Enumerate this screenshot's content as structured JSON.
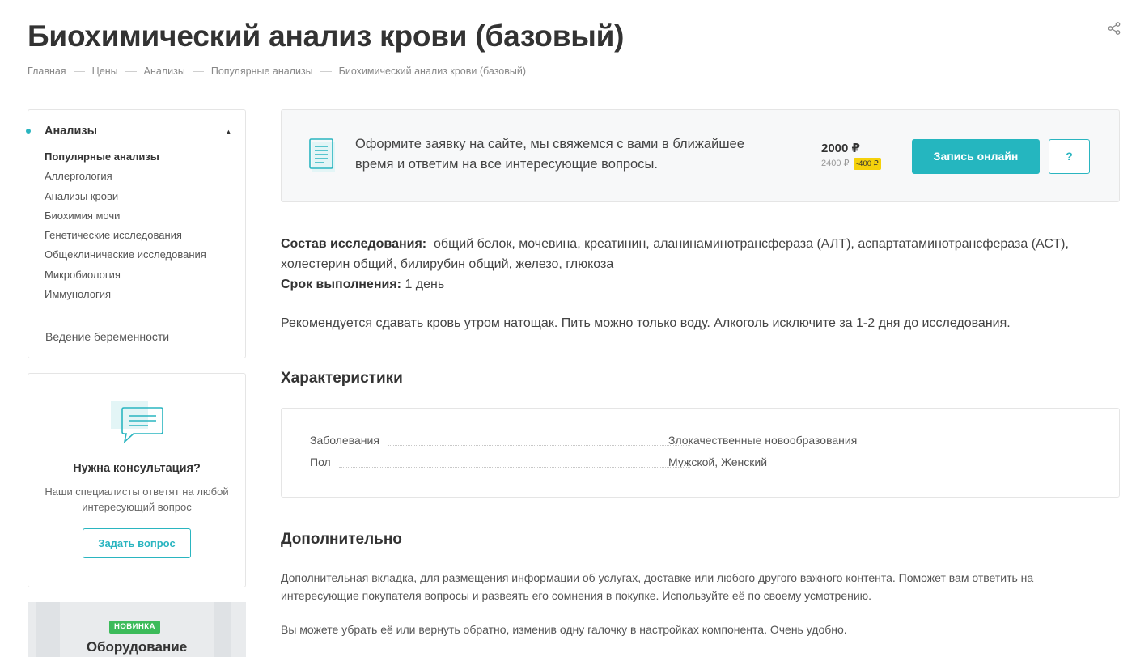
{
  "page": {
    "title": "Биохимический анализ крови (базовый)"
  },
  "breadcrumb": [
    "Главная",
    "Цены",
    "Анализы",
    "Популярные анализы",
    "Биохимический анализ крови (базовый)"
  ],
  "sidebar": {
    "heading": "Анализы",
    "items": [
      {
        "label": "Популярные анализы",
        "active": true
      },
      {
        "label": "Аллергология"
      },
      {
        "label": "Анализы крови"
      },
      {
        "label": "Биохимия мочи"
      },
      {
        "label": "Генетические исследования"
      },
      {
        "label": "Общеклинические исследования"
      },
      {
        "label": "Микробиология"
      },
      {
        "label": "Иммунология"
      }
    ],
    "extra_item": "Ведение беременности"
  },
  "consult": {
    "title": "Нужна консультация?",
    "text": "Наши специалисты ответят на любой интересующий вопрос",
    "button": "Задать вопрос"
  },
  "promo": {
    "badge": "НОВИНКА",
    "name": "Оборудование"
  },
  "order": {
    "text": "Оформите заявку на сайте, мы свяжемся с вами в ближайшее время и ответим на все интересующие вопросы.",
    "price": "2000 ₽",
    "old_price": "2400 ₽",
    "discount": "-400 ₽",
    "signup_button": "Запись онлайн",
    "question_button": "?"
  },
  "details": {
    "composition_label": "Состав исследования:",
    "composition_value": "общий белок, мочевина, креатинин, аланинаминотрансфераза (АЛТ), аспартатаминотрансфераза (АСТ), холестерин общий, билирубин общий, железо, глюкоза",
    "term_label": "Срок выполнения:",
    "term_value": "1 день",
    "recommendation": "Рекомендуется сдавать кровь утром натощак. Пить можно только воду. Алкоголь исключите за 1-2 дня до исследования."
  },
  "characteristics": {
    "heading": "Характеристики",
    "rows": [
      {
        "key": "Заболевания",
        "value": "Злокачественные новообразования"
      },
      {
        "key": "Пол",
        "value": "Мужской, Женский"
      }
    ]
  },
  "additional": {
    "heading": "Дополнительно",
    "text1": "Дополнительная вкладка, для размещения информации об услугах, доставке или любого другого важного контента. Поможет вам ответить на интересующие покупателя вопросы и развеять его сомнения в покупке. Используйте её по своему усмотрению.",
    "text2": "Вы можете убрать её или вернуть обратно, изменив одну галочку в настройках компонента. Очень удобно."
  },
  "colors": {
    "accent": "#25b6bf",
    "discount_bg": "#f5d10b",
    "new_badge": "#3cbb5a"
  }
}
